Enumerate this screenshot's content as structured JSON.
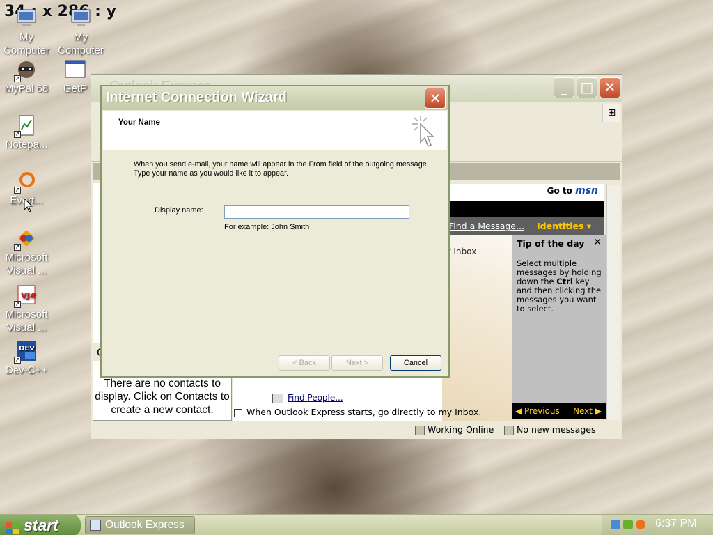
{
  "coord_readout": "34 : x 286 : y",
  "desktop_icons": [
    {
      "label_line1": "My",
      "label_line2": "Computer"
    },
    {
      "label_line1": "My",
      "label_line2": "Computer"
    },
    {
      "label_line1": "MyPal 68",
      "label_line2": ""
    },
    {
      "label_line1": "GetP",
      "label_line2": ""
    },
    {
      "label_line1": "Notepa...",
      "label_line2": ""
    },
    {
      "label_line1": "Evert...",
      "label_line2": ""
    },
    {
      "label_line1": "Microsoft",
      "label_line2": "Visual ..."
    },
    {
      "label_line1": "Microsoft",
      "label_line2": "Visual ..."
    },
    {
      "label_line1": "Dev-C++",
      "label_line2": ""
    }
  ],
  "outlook": {
    "title": "Outlook Express",
    "contacts_header": "C",
    "contacts_empty": "There are no contacts to display. Click on Contacts to create a new contact.",
    "goto_label": "Go to",
    "goto_brand": "msn",
    "find_message": "Find a Message...",
    "identities": "Identities",
    "inbox_text": "ur Inbox",
    "find_people": "Find People...",
    "startup_checkbox": "When Outlook Express starts, go directly to my Inbox.",
    "tip_title": "Tip of the day",
    "tip_body_1": "Select multiple messages by holding down the ",
    "tip_body_key": "Ctrl",
    "tip_body_2": " key and then clicking the messages you want to select.",
    "tip_prev": "Previous",
    "tip_next": "Next",
    "status_online": "Working Online",
    "status_messages": "No new messages"
  },
  "wizard": {
    "title": "Internet Connection Wizard",
    "header_title": "Your Name",
    "description_line1": "When you send e-mail, your name will appear in the From field of the outgoing message.",
    "description_line2": "Type your name as you would like it to appear.",
    "display_name_label": "Display name:",
    "display_name_value": "",
    "example_text": "For example: John Smith",
    "back_label": "< Back",
    "next_label": "Next >",
    "cancel_label": "Cancel"
  },
  "taskbar": {
    "start_label": "start",
    "task_label": "Outlook Express",
    "clock": "6:37 PM"
  }
}
